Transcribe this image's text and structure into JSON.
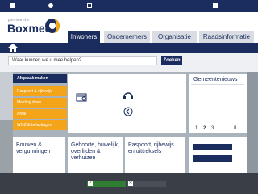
{
  "header": {
    "logo_small": "gemeente",
    "logo_big": "Boxmeer"
  },
  "tabs": [
    {
      "label": "Inwoners"
    },
    {
      "label": "Ondernemers"
    },
    {
      "label": "Organisatie"
    },
    {
      "label": "Raadsinformatie"
    }
  ],
  "search": {
    "placeholder": "Waar kunnen we u mee helpen?",
    "button": "Zoeken"
  },
  "quick_links": [
    {
      "label": "Afspraak maken"
    },
    {
      "label": "Paspoort & rijbewijs"
    },
    {
      "label": "Melding doen"
    },
    {
      "label": "Afval"
    },
    {
      "label": "WOZ & belastingen"
    }
  ],
  "news": {
    "title": "Gemeentenieuws",
    "pages": [
      "1",
      "2",
      "3"
    ],
    "pause": "II"
  },
  "cards": [
    {
      "label": "Bouwen & vergunningen"
    },
    {
      "label": "Geboorte, huwelijk, overlijden & verhuizen"
    },
    {
      "label": "Paspoort, rijbewijs en uittreksels"
    }
  ],
  "colors": {
    "navy": "#1b2d5e",
    "orange": "#f4a418",
    "accept": "#2e7d32"
  },
  "icons": [
    "home-icon",
    "calendar-icon",
    "helpdesk-icon",
    "back-arrow-icon",
    "check-icon",
    "close-icon"
  ]
}
